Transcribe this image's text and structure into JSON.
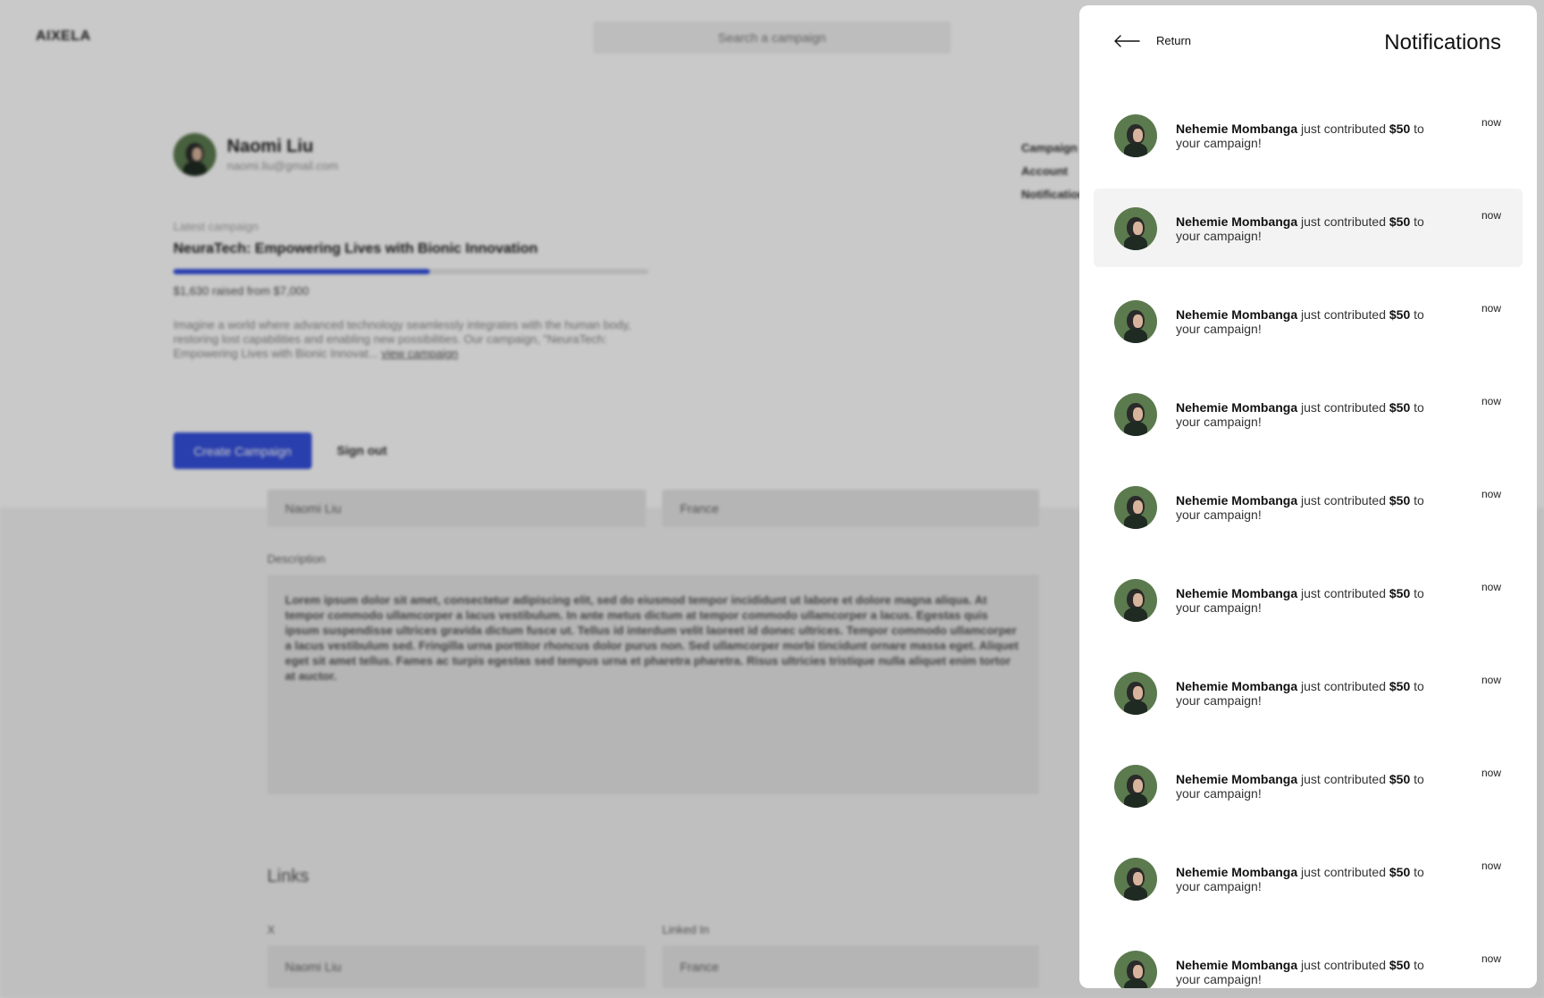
{
  "app": {
    "logo": "AIXELA"
  },
  "search": {
    "placeholder": "Search a campaign"
  },
  "profile": {
    "name": "Naomi Liu",
    "email": "naomi.liu@gmail.com"
  },
  "side_menu": [
    "Campaign",
    "Account",
    "Notification"
  ],
  "latest_campaign": {
    "label": "Latest campaign",
    "title": "NeuraTech: Empowering Lives with Bionic Innovation",
    "raised_text": "$1,630 raised from $7,000",
    "progress_fraction": 0.54,
    "description": "Imagine a world where advanced technology seamlessly integrates with the human body, restoring lost capabilities and enabling new possibilities. Our campaign, \"NeuraTech: Empowering Lives with Bionic Innovat...",
    "view_link": "view campaign"
  },
  "actions": {
    "create_campaign": "Create Campaign",
    "sign_out": "Sign out"
  },
  "form": {
    "name_value": "Naomi Liu",
    "country_value": "France",
    "description_label": "Description",
    "description_text": "Lorem ipsum dolor sit amet, consectetur adipiscing elit, sed do eiusmod tempor incididunt ut labore et dolore magna aliqua. At tempor commodo ullamcorper a lacus vestibulum. In ante metus dictum at tempor commodo ullamcorper a lacus. Egestas quis ipsum suspendisse ultrices gravida dictum fusce ut. Tellus id interdum velit laoreet id donec ultrices. Tempor commodo ullamcorper a lacus vestibulum sed. Fringilla urna porttitor rhoncus dolor purus non. Sed ullamcorper morbi tincidunt ornare massa eget. Aliquet eget sit amet tellus. Fames ac turpis egestas sed tempus urna et pharetra pharetra. Risus ultricies tristique nulla aliquet enim tortor at auctor."
  },
  "links": {
    "title": "Links",
    "x_label": "X",
    "x_value": "Naomi Liu",
    "linkedin_label": "Linked In",
    "linkedin_value": "France"
  },
  "notifications": {
    "return_label": "Return",
    "title": "Notifications",
    "items": [
      {
        "name": "Nehemie Mombanga",
        "action": " just contributed ",
        "amount": "$50",
        "tail": " to your campaign!",
        "time": "now"
      },
      {
        "name": "Nehemie Mombanga",
        "action": " just contributed ",
        "amount": "$50",
        "tail": " to your campaign!",
        "time": "now"
      },
      {
        "name": "Nehemie Mombanga",
        "action": " just contributed ",
        "amount": "$50",
        "tail": " to your campaign!",
        "time": "now"
      },
      {
        "name": "Nehemie Mombanga",
        "action": " just contributed ",
        "amount": "$50",
        "tail": " to your campaign!",
        "time": "now"
      },
      {
        "name": "Nehemie Mombanga",
        "action": " just contributed ",
        "amount": "$50",
        "tail": " to your campaign!",
        "time": "now"
      },
      {
        "name": "Nehemie Mombanga",
        "action": " just contributed ",
        "amount": "$50",
        "tail": " to your campaign!",
        "time": "now"
      },
      {
        "name": "Nehemie Mombanga",
        "action": " just contributed ",
        "amount": "$50",
        "tail": " to your campaign!",
        "time": "now"
      },
      {
        "name": "Nehemie Mombanga",
        "action": " just contributed ",
        "amount": "$50",
        "tail": " to your campaign!",
        "time": "now"
      },
      {
        "name": "Nehemie Mombanga",
        "action": " just contributed ",
        "amount": "$50",
        "tail": " to your campaign!",
        "time": "now"
      },
      {
        "name": "Nehemie Mombanga",
        "action": " just contributed ",
        "amount": "$50",
        "tail": " to your campaign!",
        "time": "now"
      }
    ]
  },
  "colors": {
    "accent": "#3550dd",
    "avatar_bg": "#5b7a4e",
    "highlight_row": "#f3f3f3"
  }
}
